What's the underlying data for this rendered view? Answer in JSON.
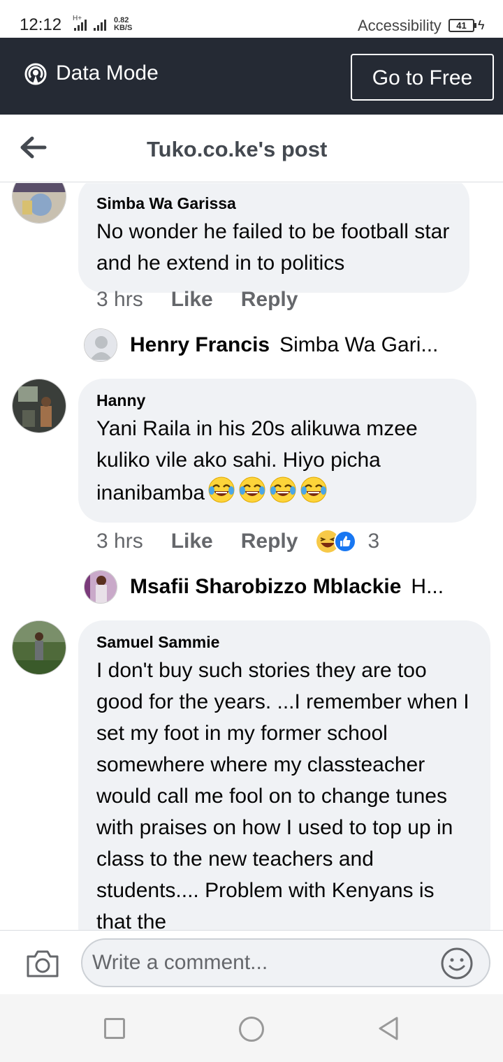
{
  "status_bar": {
    "time": "12:12",
    "network": "H+",
    "speed_value": "0.82",
    "speed_unit": "KB/S",
    "accessibility": "Accessibility",
    "battery": "41"
  },
  "data_bar": {
    "label": "Data Mode",
    "button": "Go to Free"
  },
  "header": {
    "title": "Tuko.co.ke's post"
  },
  "comments": [
    {
      "name": "Simba Wa Garissa",
      "text": "No wonder he failed to be football star and he extend in to politics",
      "time": "3 hrs",
      "like": "Like",
      "reply": "Reply",
      "reply_preview": {
        "name": "Henry Francis",
        "snippet": "Simba Wa Gari..."
      }
    },
    {
      "name": "Hanny",
      "text": "Yani Raila in his 20s alikuwa mzee kuliko vile ako sahi. Hiyo picha inanibamba",
      "emoji_count": 4,
      "time": "3 hrs",
      "like": "Like",
      "reply": "Reply",
      "reactions": {
        "types": [
          "haha",
          "like"
        ],
        "count": "3"
      },
      "reply_preview": {
        "name": "Msafii Sharobizzo Mblackie",
        "snippet": "H..."
      }
    },
    {
      "name": "Samuel Sammie",
      "text": "I don't buy such stories they are too good for the years. ...I remember when I set my foot in my former school somewhere where my classteacher would call me fool on to change tunes with praises on how I used to top up in class to the new teachers and students.... Problem with Kenyans is that the"
    }
  ],
  "composer": {
    "placeholder": "Write a comment..."
  },
  "icons": {
    "data_mode": "broadcast-icon",
    "back": "arrow-left-icon",
    "camera": "camera-icon",
    "emoji": "smile-icon"
  },
  "colors": {
    "data_bar_bg": "#252a34",
    "bubble_bg": "#f0f2f5",
    "secondary_text": "#65676b",
    "header_title": "#444950"
  }
}
